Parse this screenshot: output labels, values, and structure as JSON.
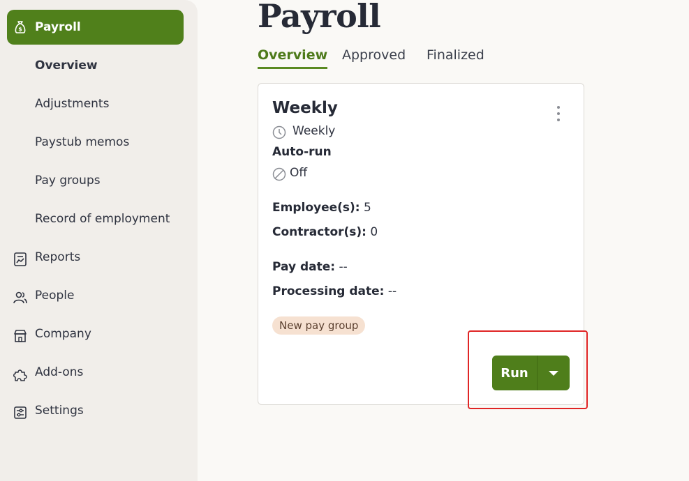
{
  "sidebar": {
    "active": {
      "label": "Payroll",
      "icon": "money-bag-icon"
    },
    "subitems": [
      {
        "label": "Overview",
        "current": true
      },
      {
        "label": "Adjustments"
      },
      {
        "label": "Paystub memos"
      },
      {
        "label": "Pay groups"
      },
      {
        "label": "Record of employment"
      }
    ],
    "items": [
      {
        "label": "Reports",
        "icon": "report-icon"
      },
      {
        "label": "People",
        "icon": "people-icon"
      },
      {
        "label": "Company",
        "icon": "store-icon"
      },
      {
        "label": "Add-ons",
        "icon": "puzzle-icon"
      },
      {
        "label": "Settings",
        "icon": "settings-icon"
      }
    ]
  },
  "main": {
    "title": "Payroll",
    "tabs": [
      {
        "label": "Overview",
        "active": true
      },
      {
        "label": "Approved"
      },
      {
        "label": "Finalized"
      }
    ]
  },
  "card": {
    "title": "Weekly",
    "frequency": "Weekly",
    "autorun_label": "Auto-run",
    "autorun_value": "Off",
    "employees_label": "Employee(s):",
    "employees_value": "5",
    "contractors_label": "Contractor(s):",
    "contractors_value": "0",
    "pay_date_label": "Pay date:",
    "pay_date_value": "--",
    "processing_date_label": "Processing date:",
    "processing_date_value": "--",
    "badge": "New pay group",
    "run_label": "Run"
  },
  "colors": {
    "accent": "#50801b",
    "badge_bg": "#f6e1d1",
    "highlight": "#e02525"
  }
}
